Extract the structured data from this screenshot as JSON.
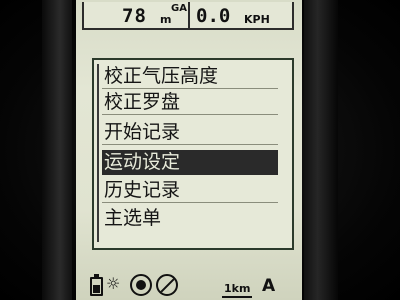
{
  "status_bar": {
    "altitude_value": "78",
    "altitude_unit": "m",
    "altitude_flag": "GA",
    "speed_value": "0.0",
    "speed_unit": "KPH"
  },
  "menu": {
    "items": [
      {
        "label": "校正气压高度",
        "selected": false
      },
      {
        "label": "校正罗盘",
        "selected": false
      },
      {
        "label": "开始记录",
        "selected": false
      },
      {
        "label": "运动设定",
        "selected": true
      },
      {
        "label": "历史记录",
        "selected": false
      },
      {
        "label": "主选单",
        "selected": false
      }
    ]
  },
  "bottom_bar": {
    "icons": [
      "battery-icon",
      "sun-icon",
      "target-icon",
      "no-signal-icon"
    ],
    "sun_glyph": "☼",
    "scale": "1km",
    "mode": "A"
  }
}
